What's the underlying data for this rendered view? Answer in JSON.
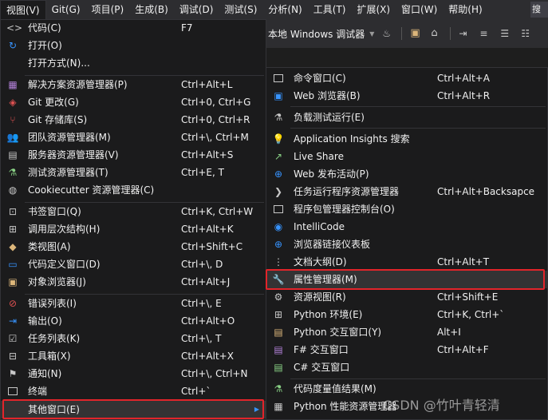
{
  "menubar": {
    "items": [
      "视图(V)",
      "Git(G)",
      "项目(P)",
      "生成(B)",
      "调试(D)",
      "测试(S)",
      "分析(N)",
      "工具(T)",
      "扩展(X)",
      "窗口(W)",
      "帮助(H)"
    ],
    "search": "搜索"
  },
  "toolbar": {
    "target_label": "本地 Windows 调试器"
  },
  "view_menu": {
    "items": [
      {
        "label": "代码(C)",
        "shortcut": "F7",
        "icon": "code-icon"
      },
      {
        "label": "打开(O)",
        "shortcut": "",
        "icon": "open-icon"
      },
      {
        "label": "打开方式(N)...",
        "shortcut": "",
        "icon": ""
      },
      {
        "label": "解决方案资源管理器(P)",
        "shortcut": "Ctrl+Alt+L",
        "icon": "solution-explorer-icon"
      },
      {
        "label": "Git 更改(G)",
        "shortcut": "Ctrl+0, Ctrl+G",
        "icon": "git-changes-icon"
      },
      {
        "label": "Git 存储库(S)",
        "shortcut": "Ctrl+0, Ctrl+R",
        "icon": "git-repo-icon"
      },
      {
        "label": "团队资源管理器(M)",
        "shortcut": "Ctrl+\\, Ctrl+M",
        "icon": "team-explorer-icon"
      },
      {
        "label": "服务器资源管理器(V)",
        "shortcut": "Ctrl+Alt+S",
        "icon": "server-explorer-icon"
      },
      {
        "label": "测试资源管理器(T)",
        "shortcut": "Ctrl+E, T",
        "icon": "test-explorer-icon"
      },
      {
        "label": "Cookiecutter 资源管理器(C)",
        "shortcut": "",
        "icon": "cookiecutter-icon"
      },
      {
        "label": "书签窗口(Q)",
        "shortcut": "Ctrl+K, Ctrl+W",
        "icon": "bookmark-icon"
      },
      {
        "label": "调用层次结构(H)",
        "shortcut": "Ctrl+Alt+K",
        "icon": "call-hierarchy-icon"
      },
      {
        "label": "类视图(A)",
        "shortcut": "Ctrl+Shift+C",
        "icon": "class-view-icon"
      },
      {
        "label": "代码定义窗口(D)",
        "shortcut": "Ctrl+\\, D",
        "icon": "code-definition-icon"
      },
      {
        "label": "对象浏览器(J)",
        "shortcut": "Ctrl+Alt+J",
        "icon": "object-browser-icon"
      },
      {
        "label": "错误列表(I)",
        "shortcut": "Ctrl+\\, E",
        "icon": "error-list-icon"
      },
      {
        "label": "输出(O)",
        "shortcut": "Ctrl+Alt+O",
        "icon": "output-icon"
      },
      {
        "label": "任务列表(K)",
        "shortcut": "Ctrl+\\, T",
        "icon": "task-list-icon"
      },
      {
        "label": "工具箱(X)",
        "shortcut": "Ctrl+Alt+X",
        "icon": "toolbox-icon"
      },
      {
        "label": "通知(N)",
        "shortcut": "Ctrl+\\, Ctrl+N",
        "icon": "notification-icon"
      },
      {
        "label": "终端",
        "shortcut": "Ctrl+`",
        "icon": "terminal-icon"
      },
      {
        "label": "其他窗口(E)",
        "shortcut": "",
        "icon": ""
      }
    ]
  },
  "other_windows_menu": {
    "items": [
      {
        "label": "命令窗口(C)",
        "shortcut": "Ctrl+Alt+A",
        "icon": "command-window-icon"
      },
      {
        "label": "Web 浏览器(B)",
        "shortcut": "Ctrl+Alt+R",
        "icon": "web-browser-icon"
      },
      {
        "label": "负载测试运行(E)",
        "shortcut": "",
        "icon": "load-test-icon"
      },
      {
        "label": "Application Insights 搜索",
        "shortcut": "",
        "icon": "app-insights-icon"
      },
      {
        "label": "Live Share",
        "shortcut": "",
        "icon": "live-share-icon"
      },
      {
        "label": "Web 发布活动(P)",
        "shortcut": "",
        "icon": "web-publish-icon"
      },
      {
        "label": "任务运行程序资源管理器",
        "shortcut": "Ctrl+Alt+Backsapce",
        "icon": "task-runner-icon"
      },
      {
        "label": "程序包管理器控制台(O)",
        "shortcut": "",
        "icon": "package-console-icon"
      },
      {
        "label": "IntelliCode",
        "shortcut": "",
        "icon": "intellicode-icon"
      },
      {
        "label": "浏览器链接仪表板",
        "shortcut": "",
        "icon": "browser-link-icon"
      },
      {
        "label": "文档大纲(D)",
        "shortcut": "Ctrl+Alt+T",
        "icon": "document-outline-icon"
      },
      {
        "label": "属性管理器(M)",
        "shortcut": "",
        "icon": "wrench-icon"
      },
      {
        "label": "资源视图(R)",
        "shortcut": "Ctrl+Shift+E",
        "icon": "resource-view-icon"
      },
      {
        "label": "Python 环境(E)",
        "shortcut": "Ctrl+K, Ctrl+`",
        "icon": "python-env-icon"
      },
      {
        "label": "Python 交互窗口(Y)",
        "shortcut": "Alt+I",
        "icon": "python-interactive-icon"
      },
      {
        "label": "F# 交互窗口",
        "shortcut": "Ctrl+Alt+F",
        "icon": "fsharp-interactive-icon"
      },
      {
        "label": "C# 交互窗口",
        "shortcut": "",
        "icon": "csharp-interactive-icon"
      },
      {
        "label": "代码度量值结果(M)",
        "shortcut": "",
        "icon": "code-metrics-icon"
      },
      {
        "label": "Python 性能资源管理器",
        "shortcut": "",
        "icon": "python-perf-icon"
      }
    ]
  },
  "watermark": "CSDN @竹叶青轻清",
  "colors": {
    "highlight_border": "#e2242a",
    "menu_bg": "#1b1b1c",
    "menubar_bg": "#2d2d30"
  }
}
